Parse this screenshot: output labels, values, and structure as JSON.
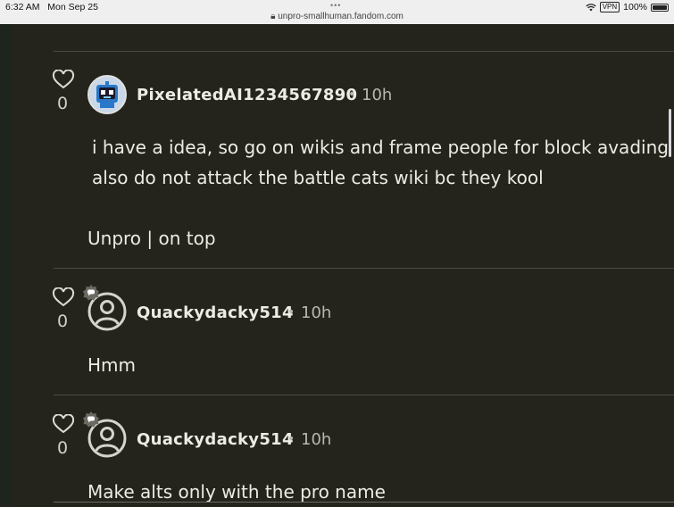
{
  "status_bar": {
    "time": "6:32 AM",
    "date": "Mon Sep 25",
    "url": "unpro-smallhuman.fandom.com",
    "vpn_label": "VPN",
    "battery": "100%"
  },
  "comments": [
    {
      "likes": "0",
      "username": "PixelatedAI1234567890",
      "time": "10h",
      "lines": [
        "i have a idea, so go on wikis and frame people for block avading",
        "also do not attack the battle cats wiki bc they kool"
      ],
      "signature": "Unpro | on top"
    },
    {
      "likes": "0",
      "username": "Quackydacky514",
      "time": "10h",
      "text": "Hmm"
    },
    {
      "likes": "0",
      "username": "Quackydacky514",
      "time": "10h",
      "text": "Make alts only with the pro name"
    }
  ]
}
